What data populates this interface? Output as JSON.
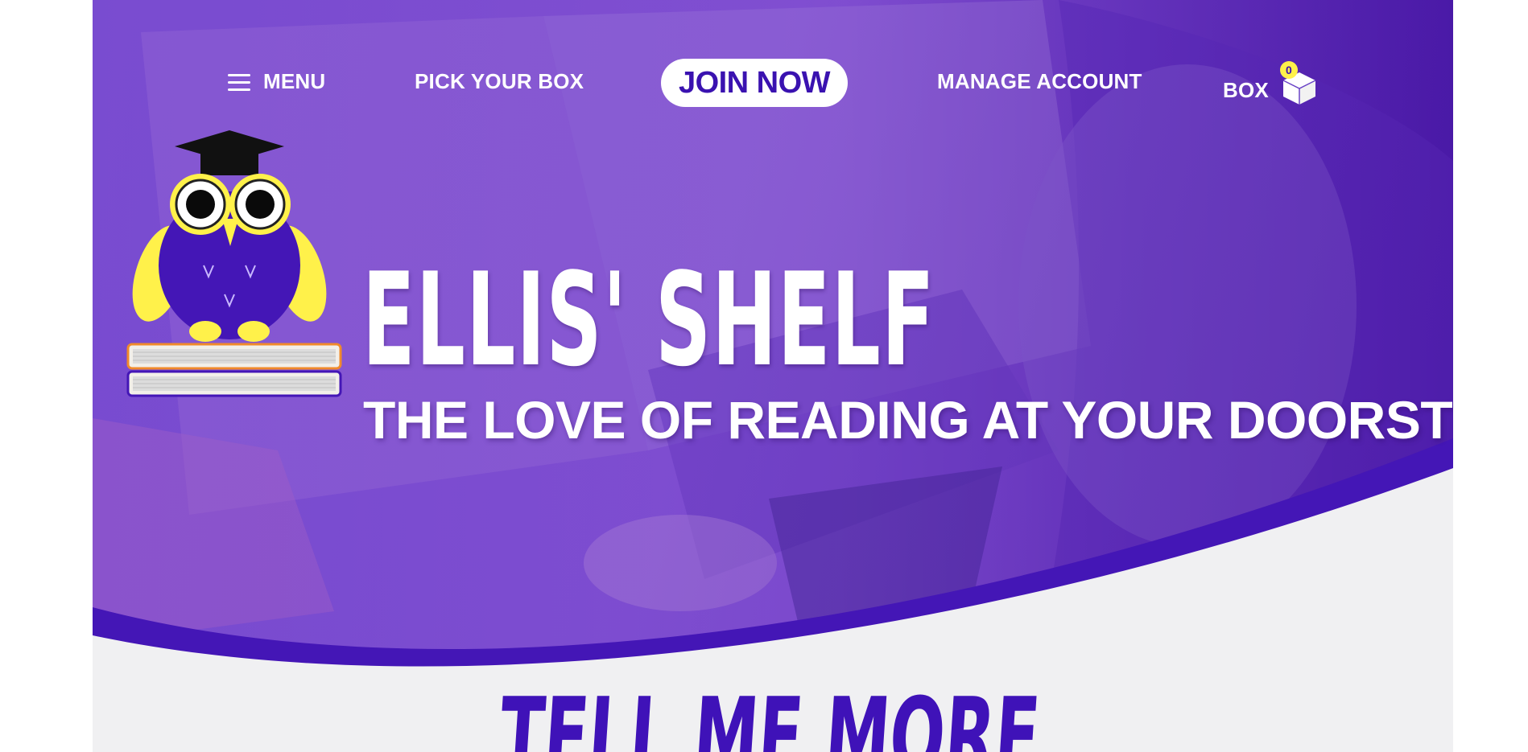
{
  "nav": {
    "menu_label": "MENU",
    "pick_label": "PICK YOUR BOX",
    "join_label": "JOIN NOW",
    "manage_label": "MANAGE ACCOUNT",
    "box_label": "BOX",
    "box_count": "0"
  },
  "hero": {
    "title": "ELLIS' SHELF",
    "tagline": "THE LOVE OF READING AT YOUR DOORSTEP"
  },
  "section": {
    "title": "TELL ME MORE"
  },
  "colors": {
    "brand_purple": "#3f12b8",
    "accent_yellow": "#fff14a",
    "background": "#f0f0f2"
  }
}
